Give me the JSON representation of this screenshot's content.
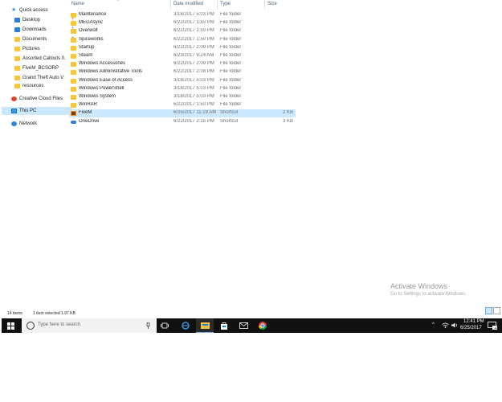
{
  "columns": {
    "name": "Name",
    "date": "Date modified",
    "type": "Type",
    "size": "Size"
  },
  "nav": [
    {
      "label": "Quick access",
      "icon": "star-icon",
      "pin": false
    },
    {
      "label": "Desktop",
      "icon": "desktop-icon",
      "pin": true
    },
    {
      "label": "Downloads",
      "icon": "download-icon",
      "pin": true
    },
    {
      "label": "Documents",
      "icon": "documents-icon",
      "pin": true
    },
    {
      "label": "Pictures",
      "icon": "pictures-icon",
      "pin": true
    },
    {
      "label": "Assorted Callouts 0.",
      "icon": "folder-icon",
      "pin": false
    },
    {
      "label": "FiveM_BCSORP",
      "icon": "folder-icon",
      "pin": false
    },
    {
      "label": "Grand Theft Auto V",
      "icon": "folder-icon",
      "pin": false
    },
    {
      "label": "resources",
      "icon": "folder-icon",
      "pin": false
    },
    {
      "label": "Creative Cloud Files",
      "icon": "creative-cloud-icon",
      "pin": false
    },
    {
      "label": "This PC",
      "icon": "computer-icon",
      "pin": false,
      "selected": true
    },
    {
      "label": "Network",
      "icon": "network-icon",
      "pin": false
    }
  ],
  "files": [
    {
      "name": "Maintenance",
      "date": "3/18/2017 5:03 PM",
      "type": "File folder",
      "size": "",
      "icon": "folder-icon"
    },
    {
      "name": "MEGAsync",
      "date": "6/22/2017 1:50 PM",
      "type": "File folder",
      "size": "",
      "icon": "folder-icon"
    },
    {
      "name": "Overwolf",
      "date": "6/22/2017 1:50 PM",
      "type": "File folder",
      "size": "",
      "icon": "folder-icon"
    },
    {
      "name": "Spiceworks",
      "date": "6/22/2017 1:50 PM",
      "type": "File folder",
      "size": "",
      "icon": "folder-icon"
    },
    {
      "name": "Startup",
      "date": "6/22/2017 2:09 PM",
      "type": "File folder",
      "size": "",
      "icon": "folder-icon"
    },
    {
      "name": "Steam",
      "date": "6/23/2017 9:24 AM",
      "type": "File folder",
      "size": "",
      "icon": "folder-icon"
    },
    {
      "name": "Windows Accessories",
      "date": "6/22/2017 2:09 PM",
      "type": "File folder",
      "size": "",
      "icon": "folder-icon"
    },
    {
      "name": "Windows Administrative Tools",
      "date": "6/22/2017 2:08 PM",
      "type": "File folder",
      "size": "",
      "icon": "folder-icon"
    },
    {
      "name": "Windows Ease of Access",
      "date": "3/18/2017 5:03 PM",
      "type": "File folder",
      "size": "",
      "icon": "folder-icon"
    },
    {
      "name": "Windows PowerShell",
      "date": "3/18/2017 5:03 PM",
      "type": "File folder",
      "size": "",
      "icon": "folder-icon"
    },
    {
      "name": "Windows System",
      "date": "3/18/2017 5:03 PM",
      "type": "File folder",
      "size": "",
      "icon": "folder-icon"
    },
    {
      "name": "WinRAR",
      "date": "6/22/2017 1:50 PM",
      "type": "File folder",
      "size": "",
      "icon": "folder-icon"
    },
    {
      "name": "FiveM",
      "date": "6/25/2017 11:19 AM",
      "type": "Shortcut",
      "size": "2 KB",
      "icon": "fivem-icon",
      "selected": true
    },
    {
      "name": "OneDrive",
      "date": "6/22/2017 2:15 PM",
      "type": "Shortcut",
      "size": "3 KB",
      "icon": "onedrive-icon"
    }
  ],
  "status": {
    "count": "14 items",
    "selection": "1 item selected  1.97 KB"
  },
  "watermark": {
    "title": "Activate Windows",
    "subtitle": "Go to Settings to activate Windows."
  },
  "taskbar": {
    "search_placeholder": "Type here to search",
    "time": "12:41 PM",
    "date": "6/25/2017",
    "notifications": "12"
  },
  "colors": {
    "selection": "#cce8ff",
    "folder": "#f5c542",
    "taskbar": "#101010",
    "accent": "#0078d7"
  }
}
